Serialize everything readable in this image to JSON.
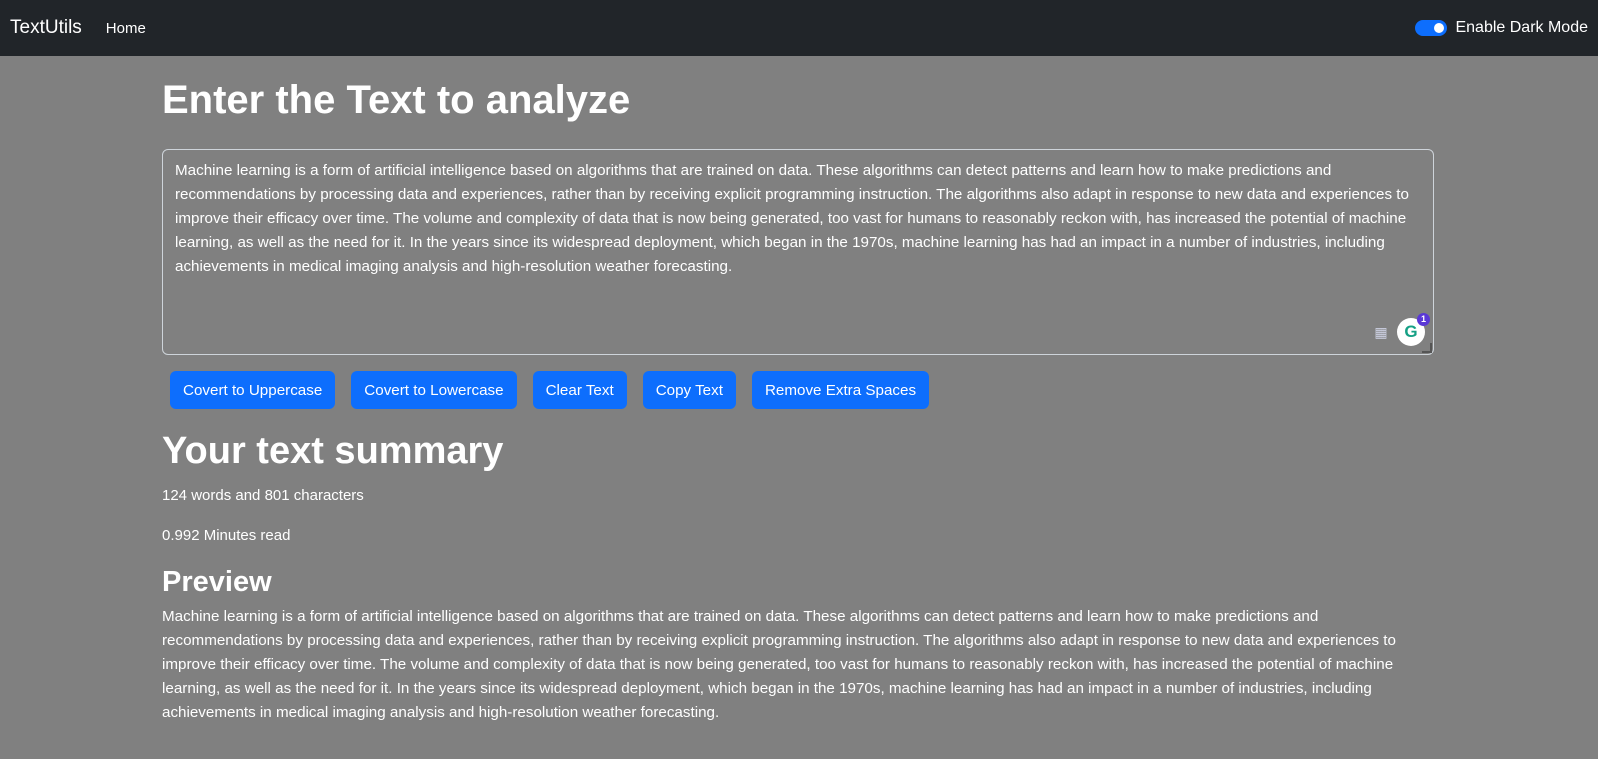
{
  "navbar": {
    "brand": "TextUtils",
    "home_link": "Home",
    "dark_mode_label": "Enable Dark Mode",
    "dark_mode_enabled": true
  },
  "main": {
    "heading": "Enter the Text to analyze",
    "textarea_value": "Machine learning is a form of artificial intelligence based on algorithms that are trained on data. These algorithms can detect patterns and learn how to make predictions and recommendations by processing data and experiences, rather than by receiving explicit programming instruction. The algorithms also adapt in response to new data and experiences to improve their efficacy over time. The volume and complexity of data that is now being generated, too vast for humans to reasonably reckon with, has increased the potential of machine learning, as well as the need for it. In the years since its widespread deployment, which began in the 1970s, machine learning has had an impact in a number of industries, including achievements in medical imaging analysis and high-resolution weather forecasting.",
    "grammarly_count": "1",
    "buttons": {
      "uppercase": "Covert to Uppercase",
      "lowercase": "Covert to Lowercase",
      "clear": "Clear Text",
      "copy": "Copy Text",
      "remove_spaces": "Remove Extra Spaces"
    }
  },
  "summary": {
    "heading": "Your text summary",
    "counts": "124 words and 801 characters",
    "read_time": "0.992 Minutes read"
  },
  "preview": {
    "heading": "Preview",
    "text": "Machine learning is a form of artificial intelligence based on algorithms that are trained on data. These algorithms can detect patterns and learn how to make predictions and recommendations by processing data and experiences, rather than by receiving explicit programming instruction. The algorithms also adapt in response to new data and experiences to improve their efficacy over time. The volume and complexity of data that is now being generated, too vast for humans to reasonably reckon with, has increased the potential of machine learning, as well as the need for it. In the years since its widespread deployment, which began in the 1970s, machine learning has had an impact in a number of industries, including achievements in medical imaging analysis and high-resolution weather forecasting."
  },
  "colors": {
    "navbar_bg": "#212529",
    "page_bg": "#808080",
    "button_primary": "#0d6efd"
  },
  "icons": [
    "grammarly-icon",
    "text-tool-icon",
    "toggle-switch-icon"
  ]
}
